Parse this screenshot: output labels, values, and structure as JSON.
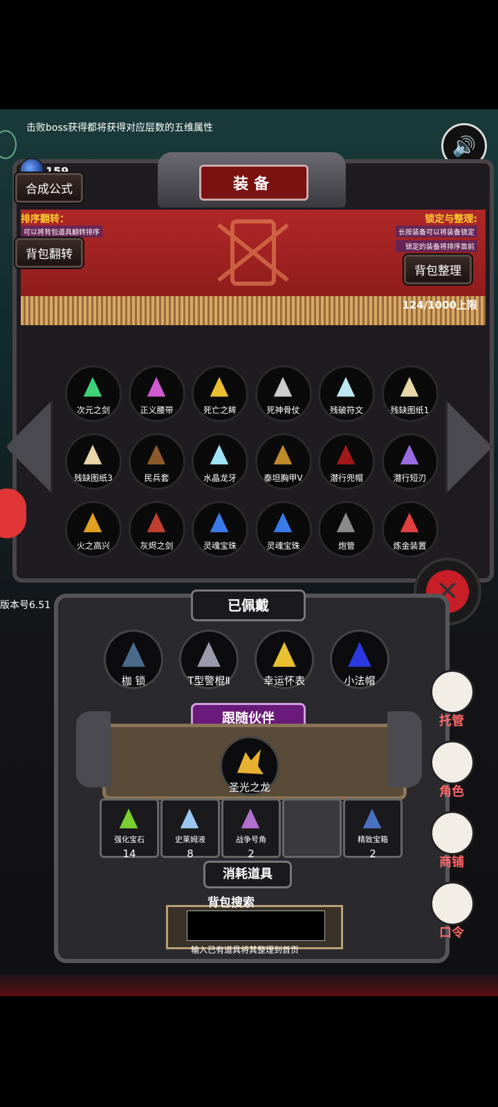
{
  "hint_text": "击败boss获得都将获得对应层数的五维属性",
  "crystal_count": "159",
  "buttons": {
    "synthesis": "合成公式",
    "bag_flip": "背包翻转",
    "bag_sort": "背包整理"
  },
  "title": "装备",
  "sort_info": {
    "heading": "排序翻转：",
    "desc": "可以将背包道具翻转排序"
  },
  "lock_info": {
    "heading": "锁定与整理:",
    "desc1": "长按装备可以将装备锁定",
    "desc2": "锁定的装备将排序靠前"
  },
  "capacity": "124/1000上限",
  "items": [
    {
      "label": "次元之剑",
      "icon": "green-sword-icon",
      "color": "#3fd07a"
    },
    {
      "label": "正义腰带",
      "icon": "belt-icon",
      "color": "#d05ad0"
    },
    {
      "label": "死亡之眸",
      "icon": "golden-orb-icon",
      "color": "#e8c030"
    },
    {
      "label": "死神骨仗",
      "icon": "bone-staff-icon",
      "color": "#cccccc"
    },
    {
      "label": "残破符文",
      "icon": "rune-stone-icon",
      "color": "#bde6f0"
    },
    {
      "label": "残缺图纸1",
      "icon": "scroll-icon",
      "color": "#e8d6a8"
    },
    {
      "label": "残缺图纸3",
      "icon": "scroll-icon",
      "color": "#e8d6a8"
    },
    {
      "label": "民兵套",
      "icon": "wooden-shield-icon",
      "color": "#8a5a2a"
    },
    {
      "label": "水晶龙牙",
      "icon": "crystal-fang-icon",
      "color": "#9ee4f4"
    },
    {
      "label": "泰坦胸甲V",
      "icon": "chest-armor-icon",
      "color": "#c08a2a"
    },
    {
      "label": "潜行兜帽",
      "icon": "red-hood-icon",
      "color": "#a01818"
    },
    {
      "label": "潜行短刃",
      "icon": "dagger-icon",
      "color": "#9a6ae0"
    },
    {
      "label": "火之高兴",
      "icon": "fire-blade-icon",
      "color": "#e0a020"
    },
    {
      "label": "灰烬之剑",
      "icon": "ash-sword-icon",
      "color": "#c04030"
    },
    {
      "label": "灵魂宝珠",
      "icon": "soul-orb-icon",
      "color": "#3a7ae8"
    },
    {
      "label": "灵魂宝珠",
      "icon": "soul-orb-icon",
      "color": "#3a7ae8"
    },
    {
      "label": "炮管",
      "icon": "cannon-barrel-icon",
      "color": "#8a8a8a"
    },
    {
      "label": "炼金装置",
      "icon": "alchemy-device-icon",
      "color": "#e04040"
    }
  ],
  "version": "版本号6.51",
  "equipped_title": "已佩戴",
  "equipped": [
    {
      "label": "枷 锁",
      "icon": "shackles-icon",
      "color": "#4a6a8a"
    },
    {
      "label": "T型警棍Ⅱ",
      "icon": "baton-icon",
      "color": "#9a9aaa"
    },
    {
      "label": "幸运怀表",
      "icon": "pocket-watch-icon",
      "color": "#e8c030"
    },
    {
      "label": "小法帽",
      "icon": "wizard-hat-icon",
      "color": "#2a3ae0"
    }
  ],
  "companion_title": "跟随伙伴",
  "companion": {
    "label": "圣光之龙",
    "icon": "golden-dragon-icon",
    "color": "#e8b030"
  },
  "consumables_title": "消耗道具",
  "consumables": [
    {
      "label": "强化宝石",
      "count": "14",
      "icon": "green-gem-icon",
      "color": "#7ad030"
    },
    {
      "label": "史莱姆液",
      "count": "8",
      "icon": "potion-icon",
      "color": "#9ac8f0"
    },
    {
      "label": "战争号角",
      "count": "2",
      "icon": "war-horn-icon",
      "color": "#b070d0"
    },
    {
      "label": "",
      "count": "",
      "icon": "",
      "color": ""
    },
    {
      "label": "精致宝箱",
      "count": "2",
      "icon": "treasure-chest-icon",
      "color": "#4a70c0"
    }
  ],
  "side_menu": [
    {
      "label": "托管",
      "icon": "dice-icon"
    },
    {
      "label": "角色",
      "icon": "hooded-character-icon"
    },
    {
      "label": "商铺",
      "icon": "shop-icon"
    },
    {
      "label": "口令",
      "icon": "code-scroll-icon"
    }
  ],
  "search": {
    "label": "背包搜索",
    "value": "",
    "hint": "输入已有道具将其整理到首页"
  }
}
